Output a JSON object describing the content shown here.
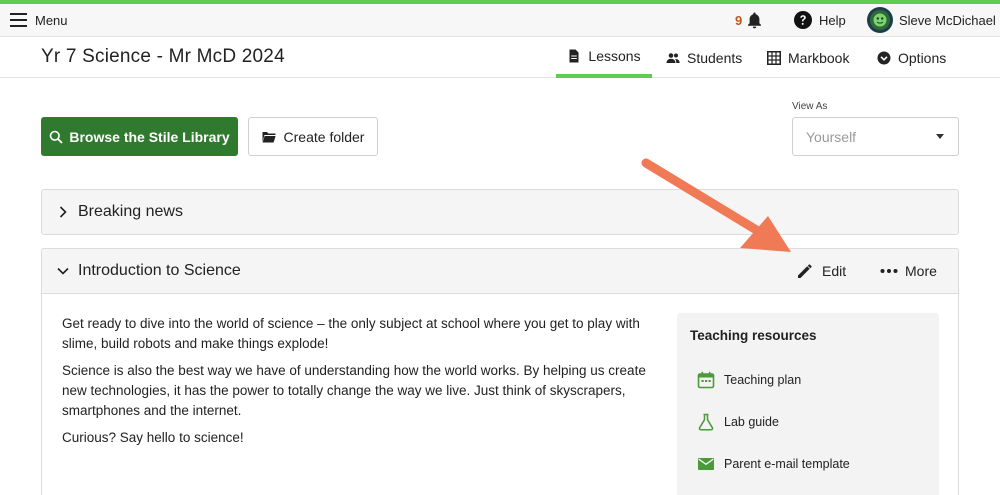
{
  "colors": {
    "accent_green": "#5ecb52",
    "brand_green": "#2f7a2f",
    "notification_orange": "#c4561b",
    "annotation_arrow": "#f07a55",
    "resource_icon_green": "#4a9a3a"
  },
  "topbar": {
    "menu_label": "Menu",
    "menu_icon": "hamburger-icon",
    "notification_count": "9",
    "notification_icon": "bell-icon",
    "help_label": "Help",
    "help_icon": "question-circle-icon",
    "user_name": "Sleve McDichael",
    "user_icon": "avatar"
  },
  "header": {
    "class_title": "Yr 7 Science - Mr McD 2024",
    "tabs": [
      {
        "label": "Lessons",
        "icon": "document-icon",
        "active": true
      },
      {
        "label": "Students",
        "icon": "people-icon",
        "active": false
      },
      {
        "label": "Markbook",
        "icon": "grid-icon",
        "active": false
      },
      {
        "label": "Options",
        "icon": "chevron-circle-icon",
        "active": false
      }
    ]
  },
  "toolbar": {
    "browse_label": "Browse the Stile Library",
    "create_folder_label": "Create folder"
  },
  "view_as": {
    "label": "View As",
    "selected": "Yourself"
  },
  "sections": [
    {
      "title": "Breaking news",
      "expanded": false
    },
    {
      "title": "Introduction to Science",
      "expanded": true,
      "edit_label": "Edit",
      "more_label": "More",
      "paragraphs": [
        "Get ready to dive into the world of science – the only subject at school where you get to play with slime, build robots and make things explode!",
        "Science is also the best way we have of understanding how the world works. By helping us create new technologies, it has the power to totally change the way we live. Just think of skyscrapers, smartphones and the internet.",
        "Curious? Say hello to science!"
      ],
      "resources": {
        "heading": "Teaching resources",
        "items": [
          {
            "label": "Teaching plan",
            "icon": "calendar-icon"
          },
          {
            "label": "Lab guide",
            "icon": "flask-icon"
          },
          {
            "label": "Parent e-mail template",
            "icon": "envelope-icon"
          }
        ]
      }
    }
  ]
}
